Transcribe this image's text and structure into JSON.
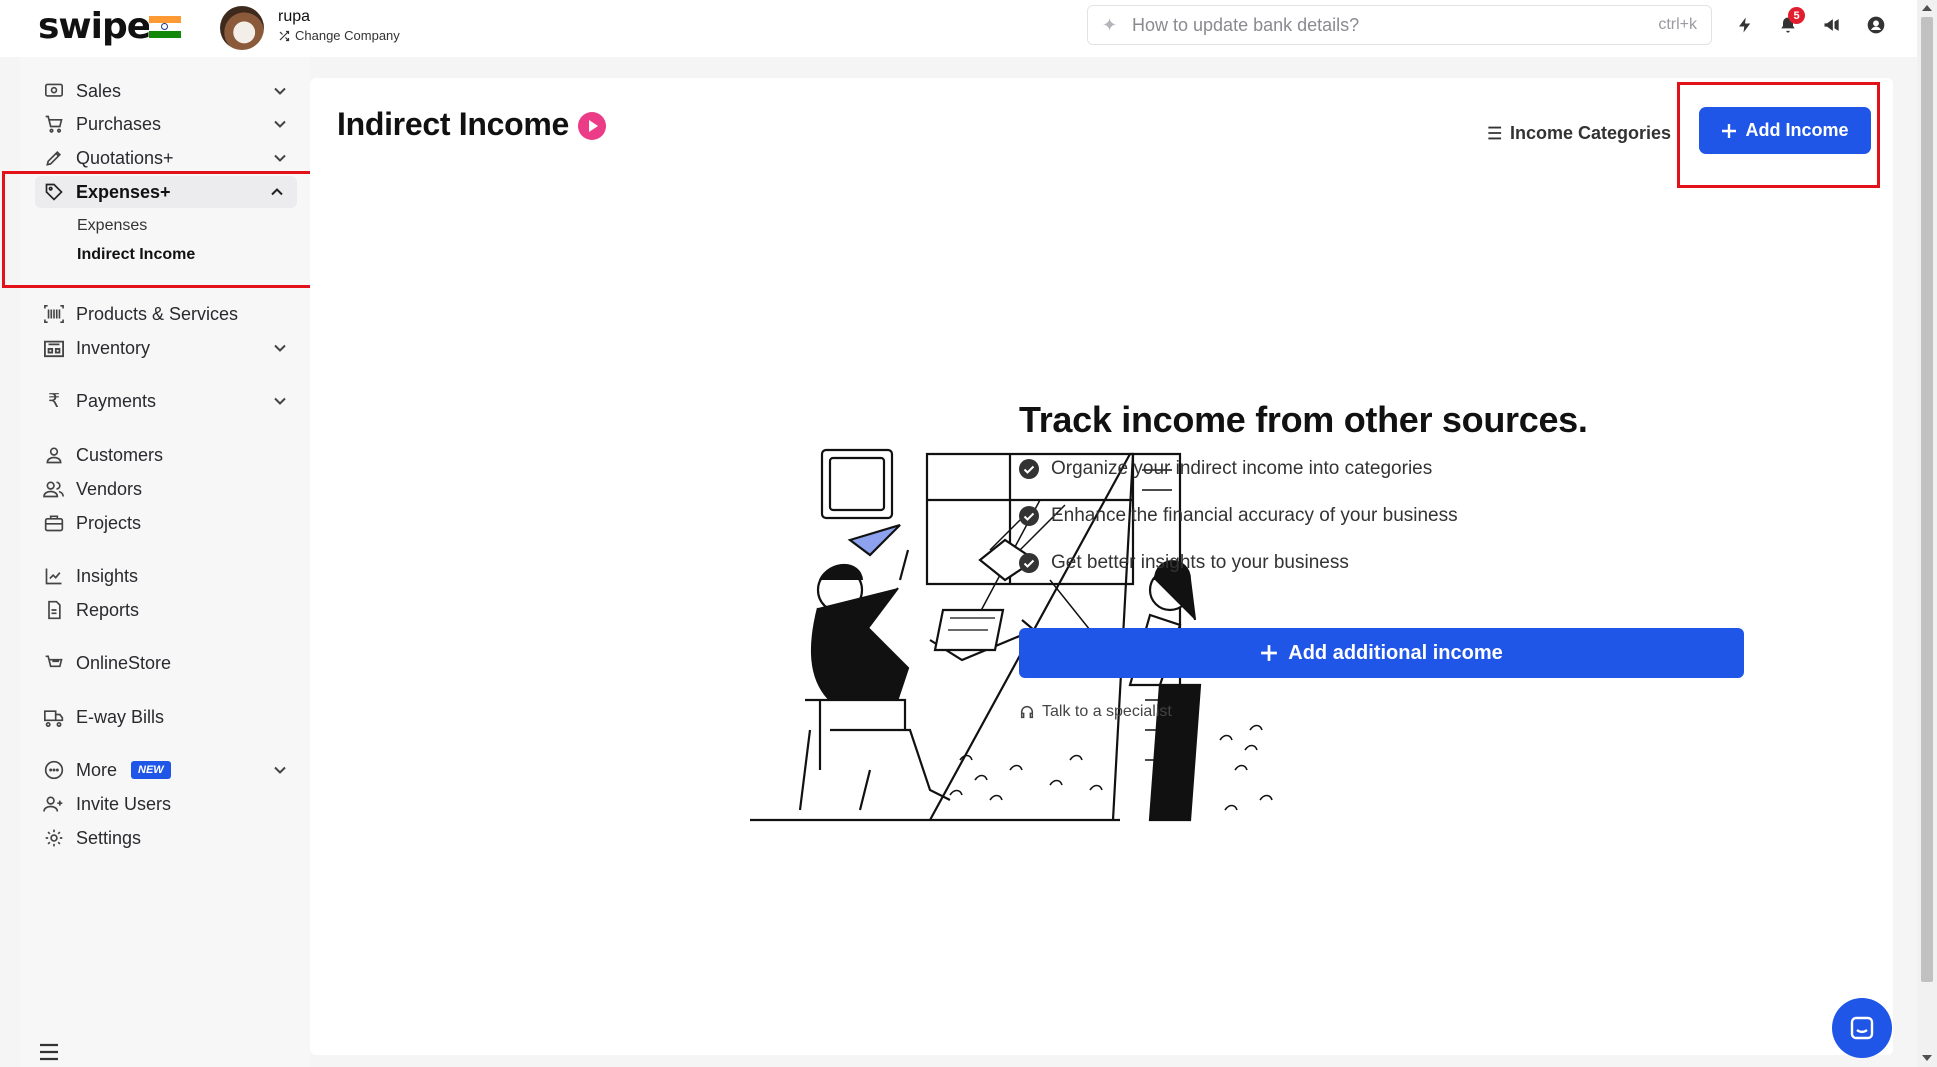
{
  "brand": {
    "logo_text": "swipe",
    "flag_colors": [
      "#ff9933",
      "#ffffff",
      "#138808"
    ]
  },
  "company": {
    "name": "rupa",
    "change_label": "Change Company"
  },
  "search": {
    "placeholder": "How to update bank details?",
    "shortcut": "ctrl+k"
  },
  "top_icons": {
    "notification_count": "5",
    "icons": [
      "lightning-icon",
      "bell-icon",
      "megaphone-icon",
      "account-icon"
    ]
  },
  "sidebar": {
    "items": [
      {
        "label": "Sales",
        "icon": "sales-icon",
        "has_chevron": true
      },
      {
        "label": "Purchases",
        "icon": "cart-icon",
        "has_chevron": true
      },
      {
        "label": "Quotations+",
        "icon": "pen-icon",
        "has_chevron": true
      },
      {
        "label": "Expenses+",
        "icon": "tag-icon",
        "expanded": true,
        "sub_items": [
          "Expenses",
          "Indirect Income"
        ]
      },
      {
        "label": "Products & Services",
        "icon": "barcode-icon"
      },
      {
        "label": "Inventory",
        "icon": "warehouse-icon",
        "has_chevron": true
      },
      {
        "label": "Payments",
        "icon": "rupee-icon",
        "has_chevron": true
      },
      {
        "label": "Customers",
        "icon": "user-icon"
      },
      {
        "label": "Vendors",
        "icon": "users-icon"
      },
      {
        "label": "Projects",
        "icon": "briefcase-icon"
      },
      {
        "label": "Insights",
        "icon": "chart-icon"
      },
      {
        "label": "Reports",
        "icon": "report-icon"
      },
      {
        "label": "OnlineStore",
        "icon": "store-icon"
      },
      {
        "label": "E-way Bills",
        "icon": "truck-icon"
      },
      {
        "label": "More",
        "icon": "more-icon",
        "badge": "NEW",
        "has_chevron": true
      },
      {
        "label": "Invite Users",
        "icon": "user-plus-icon"
      },
      {
        "label": "Settings",
        "icon": "gear-icon"
      }
    ]
  },
  "page": {
    "title": "Indirect Income",
    "categories_label": "Income Categories",
    "add_label": "Add Income"
  },
  "hero": {
    "title": "Track income from other sources.",
    "bullets": [
      "Organize your indirect income into categories",
      "Enhance the financial accuracy of your business",
      "Get better insights to your business"
    ],
    "cta_label": "Add additional income",
    "specialist_label": "Talk to a specialist"
  },
  "colors": {
    "primary": "#1f56e8",
    "highlight": "#e3121a",
    "play": "#ec3b87"
  }
}
